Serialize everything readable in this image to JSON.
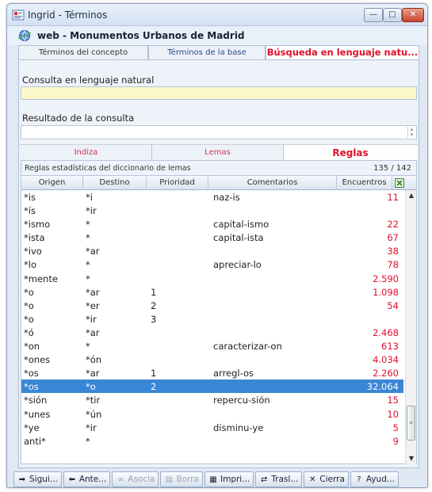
{
  "window": {
    "title": "Ingrid - Términos",
    "min": "—",
    "max": "□",
    "close": "✕"
  },
  "header": {
    "title": "web - Monumentos Urbanos de Madrid"
  },
  "tabs": [
    {
      "label": "Términos del concepto"
    },
    {
      "label": "Términos de la base"
    },
    {
      "label": "Búsqueda en lenguaje natu..."
    }
  ],
  "query": {
    "label": "Consulta en lenguaje natural",
    "value": ""
  },
  "result": {
    "label": "Resultado de la consulta",
    "value": ""
  },
  "subtabs": [
    {
      "label": "Indiza"
    },
    {
      "label": "Lemas"
    },
    {
      "label": "Reglas"
    }
  ],
  "table": {
    "title": "Reglas estadísticas del diccionario de lemas",
    "count": "135 / 142",
    "columns": [
      "Origen",
      "Destino",
      "Prioridad",
      "Comentarios",
      "Encuentros"
    ],
    "rows": [
      {
        "origen": "*is",
        "destino": "*i",
        "prioridad": "",
        "comentarios": "naz-is",
        "encuentros": "11"
      },
      {
        "origen": "*ís",
        "destino": "*ir",
        "prioridad": "",
        "comentarios": "",
        "encuentros": ""
      },
      {
        "origen": "*ismo",
        "destino": "*",
        "prioridad": "",
        "comentarios": "capital-ismo",
        "encuentros": "22"
      },
      {
        "origen": "*ista",
        "destino": "*",
        "prioridad": "",
        "comentarios": "capital-ista",
        "encuentros": "67"
      },
      {
        "origen": "*ivo",
        "destino": "*ar",
        "prioridad": "",
        "comentarios": "",
        "encuentros": "38"
      },
      {
        "origen": "*lo",
        "destino": "*",
        "prioridad": "",
        "comentarios": "apreciar-lo",
        "encuentros": "78"
      },
      {
        "origen": "*mente",
        "destino": "*",
        "prioridad": "",
        "comentarios": "",
        "encuentros": "2.590"
      },
      {
        "origen": "*o",
        "destino": "*ar",
        "prioridad": "1",
        "comentarios": "",
        "encuentros": "1.098"
      },
      {
        "origen": "*o",
        "destino": "*er",
        "prioridad": "2",
        "comentarios": "",
        "encuentros": "54"
      },
      {
        "origen": "*o",
        "destino": "*ir",
        "prioridad": "3",
        "comentarios": "",
        "encuentros": ""
      },
      {
        "origen": "*ó",
        "destino": "*ar",
        "prioridad": "",
        "comentarios": "",
        "encuentros": "2.468"
      },
      {
        "origen": "*on",
        "destino": "*",
        "prioridad": "",
        "comentarios": "caracterizar-on",
        "encuentros": "613"
      },
      {
        "origen": "*ones",
        "destino": "*ón",
        "prioridad": "",
        "comentarios": "",
        "encuentros": "4.034"
      },
      {
        "origen": "*os",
        "destino": "*ar",
        "prioridad": "1",
        "comentarios": "arregl-os",
        "encuentros": "2.260"
      },
      {
        "origen": "*os",
        "destino": "*o",
        "prioridad": "2",
        "comentarios": "",
        "encuentros": "32.064"
      },
      {
        "origen": "*sión",
        "destino": "*tir",
        "prioridad": "",
        "comentarios": "repercu-sión",
        "encuentros": "15"
      },
      {
        "origen": "*unes",
        "destino": "*ún",
        "prioridad": "",
        "comentarios": "",
        "encuentros": "10"
      },
      {
        "origen": "*ye",
        "destino": "*ir",
        "prioridad": "",
        "comentarios": "disminu-ye",
        "encuentros": "5"
      },
      {
        "origen": "anti*",
        "destino": "*",
        "prioridad": "",
        "comentarios": "",
        "encuentros": "9"
      }
    ],
    "selected_row": 14
  },
  "toolbar": [
    {
      "label": "Sigui...",
      "icon": "arrow-right-icon",
      "glyph": "➡",
      "enabled": true
    },
    {
      "label": "Ante...",
      "icon": "arrow-left-icon",
      "glyph": "⬅",
      "enabled": true
    },
    {
      "label": "Asocia",
      "icon": "link-icon",
      "glyph": "∞",
      "enabled": false
    },
    {
      "label": "Borra",
      "icon": "delete-icon",
      "glyph": "▤",
      "enabled": false
    },
    {
      "label": "Impri...",
      "icon": "printer-icon",
      "glyph": "▦",
      "enabled": true
    },
    {
      "label": "Trasl...",
      "icon": "transfer-icon",
      "glyph": "⇄",
      "enabled": true
    },
    {
      "label": "Cierra",
      "icon": "close-icon",
      "glyph": "✕",
      "enabled": true
    },
    {
      "label": "Ayud...",
      "icon": "help-icon",
      "glyph": "?",
      "enabled": true
    }
  ],
  "colors": {
    "accent_red": "#e0102d",
    "selection": "#3a86d6",
    "query_bg": "#fbf7c9"
  }
}
